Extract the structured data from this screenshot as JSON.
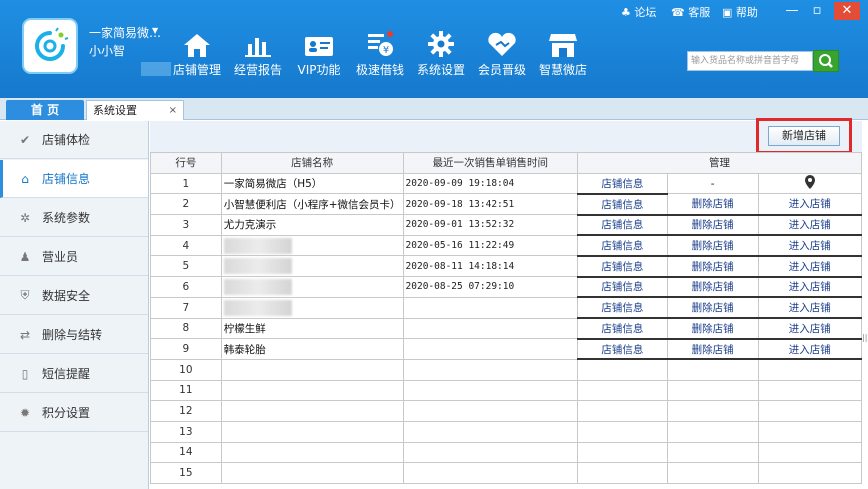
{
  "header": {
    "shop_name": "一家简易微…",
    "user_name": "小小智",
    "nav": [
      {
        "label": "店铺管理",
        "icon": "home-icon"
      },
      {
        "label": "经营报告",
        "icon": "bar-chart-icon"
      },
      {
        "label": "VIP功能",
        "icon": "vip-card-icon"
      },
      {
        "label": "极速借钱",
        "icon": "loan-icon"
      },
      {
        "label": "系统设置",
        "icon": "gear-icon"
      },
      {
        "label": "会员晋级",
        "icon": "heart-handshake-icon"
      },
      {
        "label": "智慧微店",
        "icon": "storefront-icon"
      }
    ],
    "links": {
      "forum": "论坛",
      "service": "客服",
      "help": "帮助"
    },
    "search_placeholder": "输入货品名称或拼音首字母",
    "brand_color": "#1a86dc"
  },
  "tabs": {
    "home": "首 页",
    "current": "系统设置",
    "close": "×"
  },
  "sidebar": {
    "items": [
      {
        "label": "店铺体检",
        "icon": "check-circle-icon"
      },
      {
        "label": "店铺信息",
        "icon": "shop-icon",
        "active": true
      },
      {
        "label": "系统参数",
        "icon": "settings-sun-icon"
      },
      {
        "label": "营业员",
        "icon": "person-icon"
      },
      {
        "label": "数据安全",
        "icon": "shield-icon"
      },
      {
        "label": "删除与结转",
        "icon": "transfer-icon"
      },
      {
        "label": "短信提醒",
        "icon": "phone-icon"
      },
      {
        "label": "积分设置",
        "icon": "points-gear-icon"
      }
    ]
  },
  "toolbar": {
    "add_store": "新增店铺"
  },
  "table": {
    "headers": {
      "row": "行号",
      "name": "店铺名称",
      "time": "最近一次销售单销售时间",
      "manage": "管理"
    },
    "rows": [
      {
        "no": "1",
        "name": "一家简易微店（H5）",
        "time": "2020-09-09 19:18:04",
        "info": "店铺信息",
        "delete": "-",
        "enter": "location-pin"
      },
      {
        "no": "2",
        "name": "小智慧便利店（小程序+微信会员卡）",
        "time": "2020-09-18 13:42:51",
        "info": "店铺信息",
        "delete": "删除店铺",
        "enter": "进入店铺"
      },
      {
        "no": "3",
        "name": "尤力克演示",
        "time": "2020-09-01 13:52:32",
        "info": "店铺信息",
        "delete": "删除店铺",
        "enter": "进入店铺"
      },
      {
        "no": "4",
        "name": "",
        "time": "2020-05-16 11:22:49",
        "info": "店铺信息",
        "delete": "删除店铺",
        "enter": "进入店铺"
      },
      {
        "no": "5",
        "name": "",
        "time": "2020-08-11 14:18:14",
        "info": "店铺信息",
        "delete": "删除店铺",
        "enter": "进入店铺"
      },
      {
        "no": "6",
        "name": "",
        "time": "2020-08-25 07:29:10",
        "info": "店铺信息",
        "delete": "删除店铺",
        "enter": "进入店铺"
      },
      {
        "no": "7",
        "name": "",
        "time": "",
        "info": "店铺信息",
        "delete": "删除店铺",
        "enter": "进入店铺"
      },
      {
        "no": "8",
        "name": "柠檬生鲜",
        "time": "",
        "info": "店铺信息",
        "delete": "删除店铺",
        "enter": "进入店铺"
      },
      {
        "no": "9",
        "name": "韩泰轮胎",
        "time": "",
        "info": "店铺信息",
        "delete": "删除店铺",
        "enter": "进入店铺"
      }
    ],
    "empty_rows": [
      "10",
      "11",
      "12",
      "13",
      "14",
      "15"
    ]
  }
}
